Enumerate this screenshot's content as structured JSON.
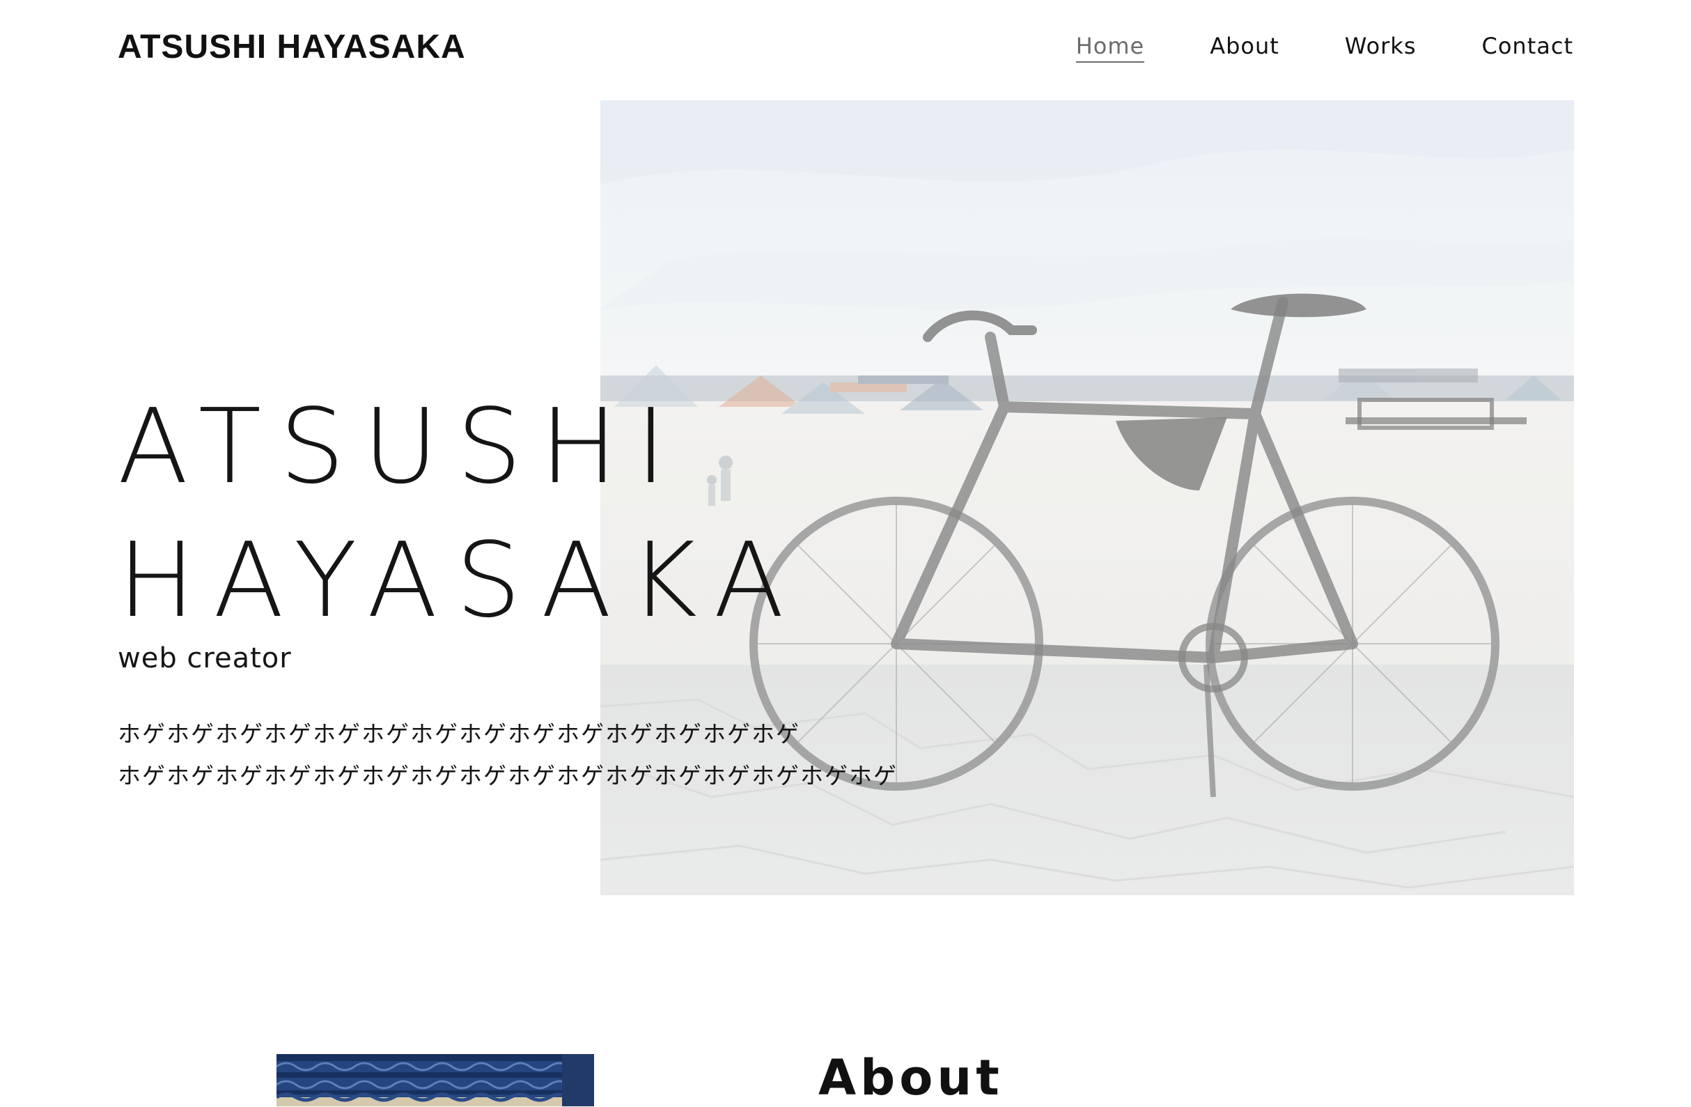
{
  "header": {
    "logo": "ATSUSHI HAYASAKA",
    "nav": [
      {
        "label": "Home",
        "active": true
      },
      {
        "label": "About",
        "active": false
      },
      {
        "label": "Works",
        "active": false
      },
      {
        "label": "Contact",
        "active": false
      }
    ]
  },
  "hero": {
    "name_line1": "ATSUSHI",
    "name_line2": "HAYASAKA",
    "subtitle": "web creator",
    "description_line1": "ホゲホゲホゲホゲホゲホゲホゲホゲホゲホゲホゲホゲホゲホゲ",
    "description_line2": "ホゲホゲホゲホゲホゲホゲホゲホゲホゲホゲホゲホゲホゲホゲホゲホゲ",
    "image": "bicycle-on-beach-photo"
  },
  "about": {
    "title": "About",
    "image": "blue-roof-photo"
  },
  "colors": {
    "text": "#111111",
    "nav_active": "#6b6b6b",
    "background": "#ffffff"
  }
}
